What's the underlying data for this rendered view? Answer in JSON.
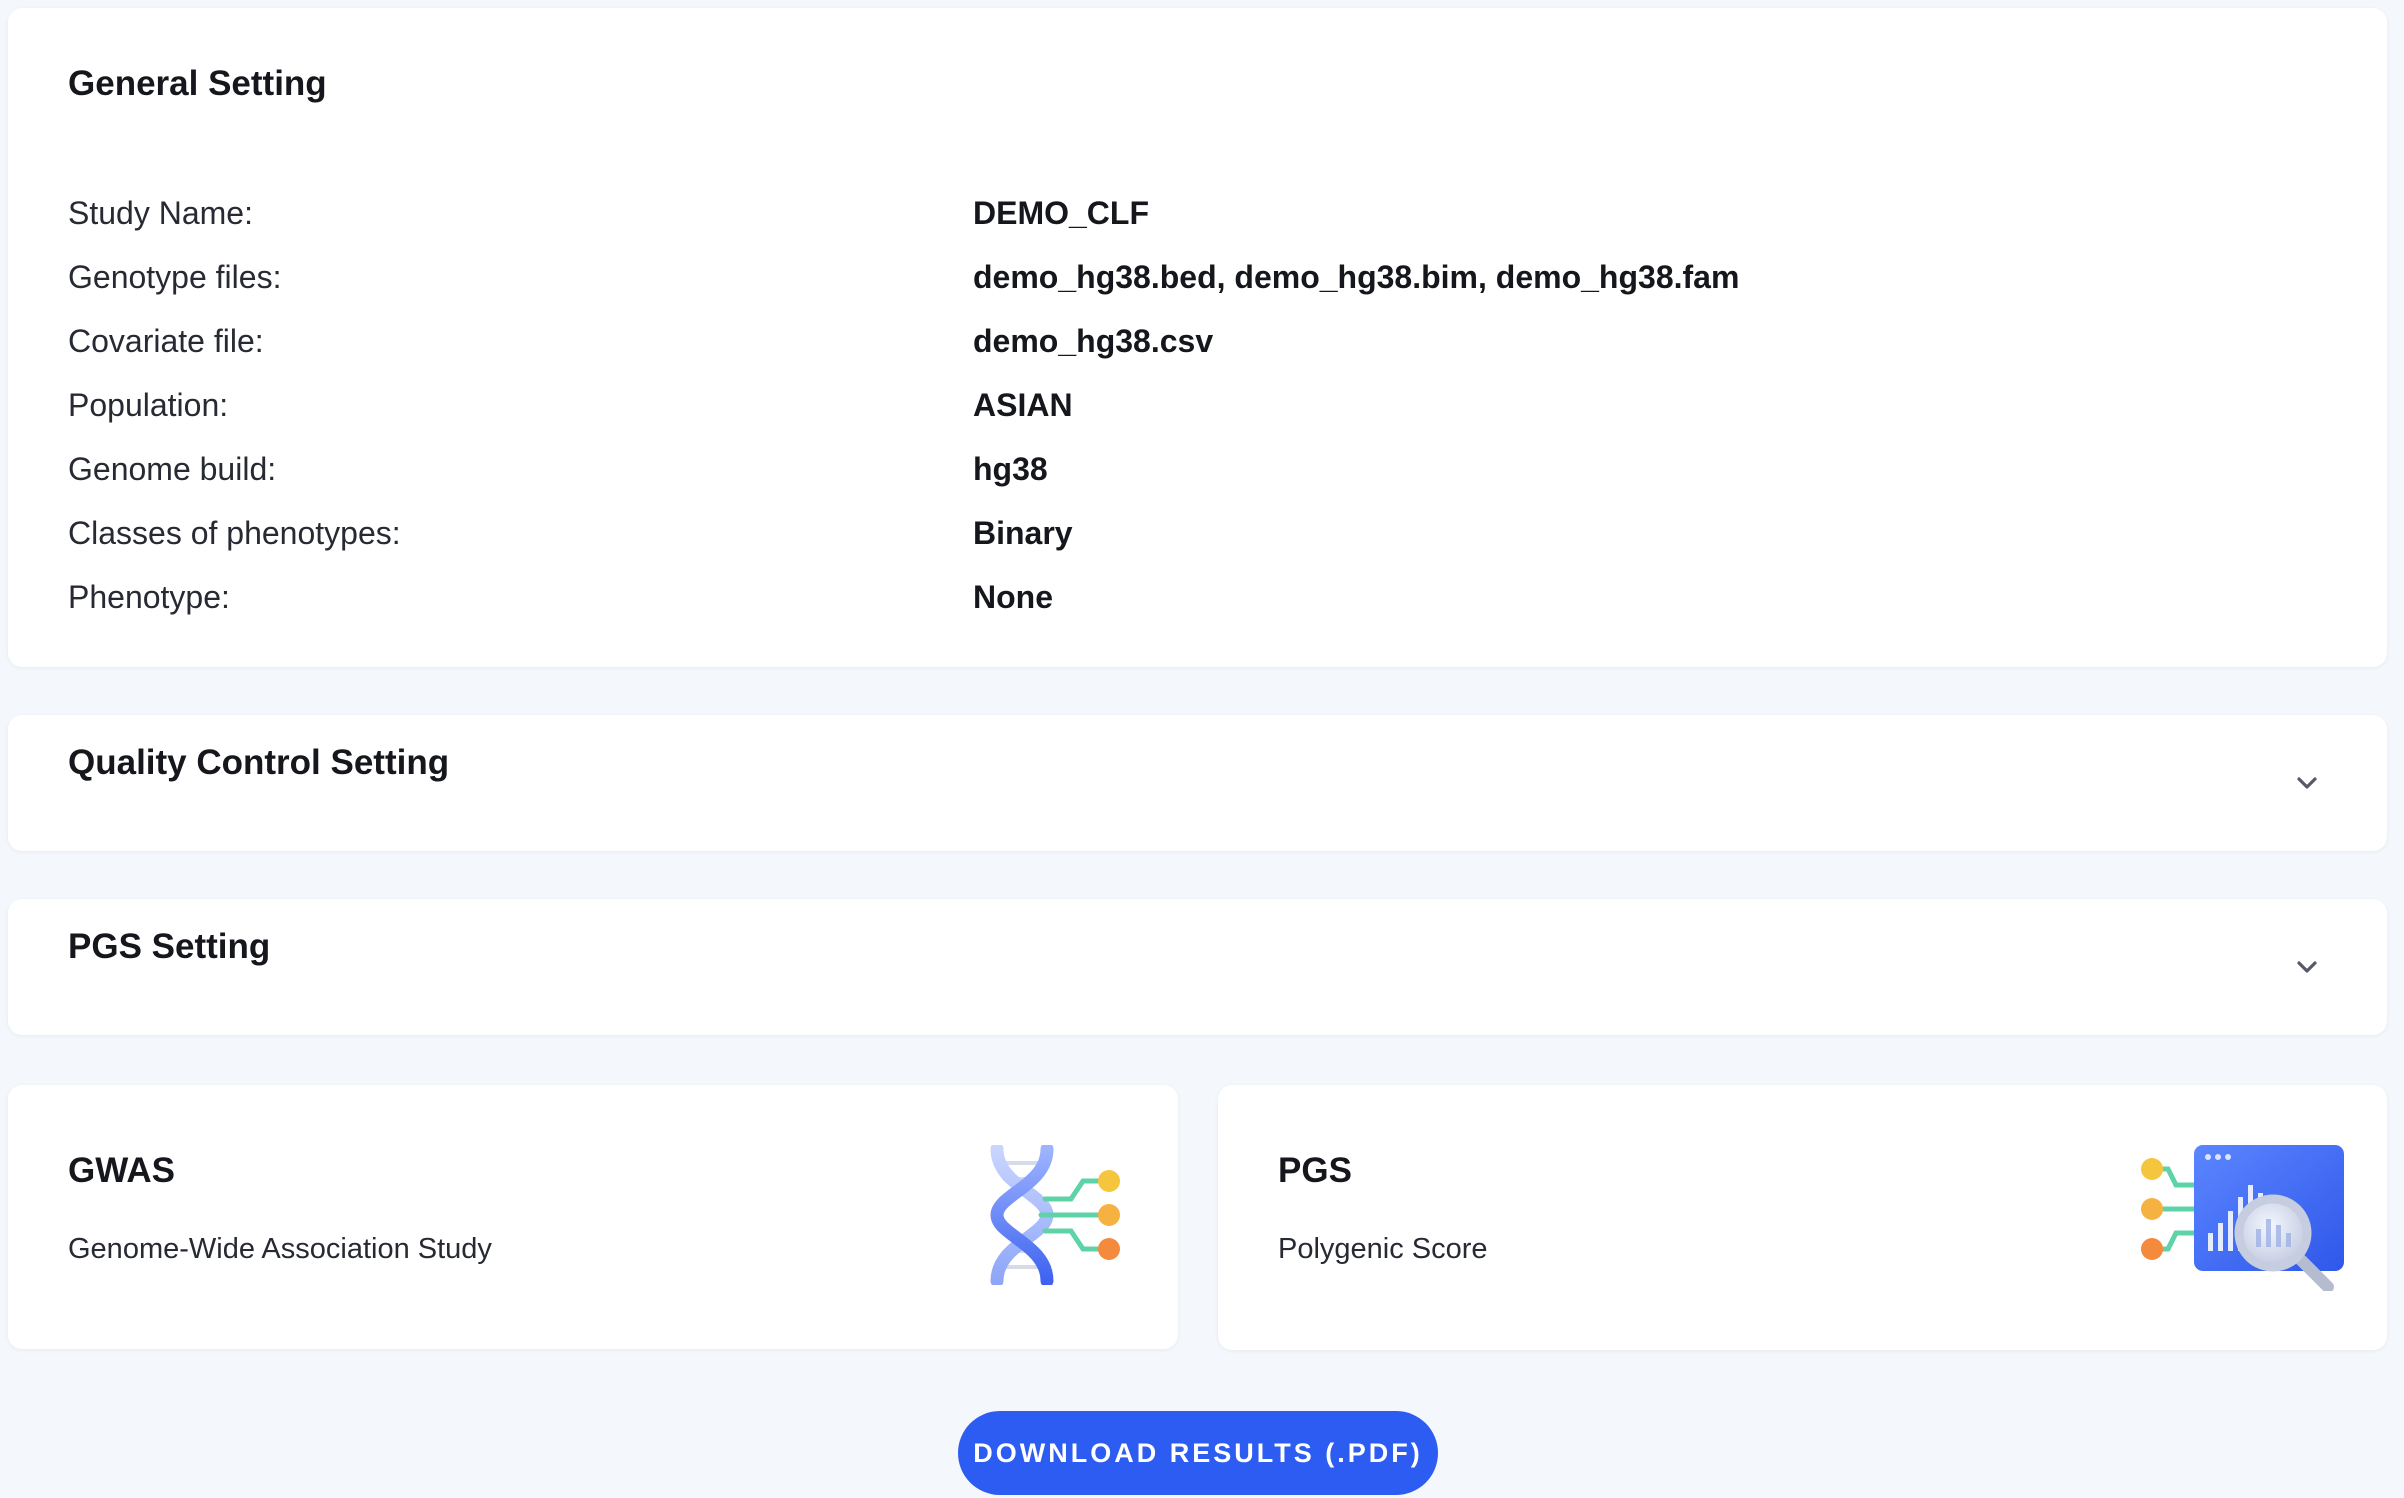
{
  "general": {
    "title": "General Setting",
    "rows": [
      {
        "label": "Study Name:",
        "value": "DEMO_CLF"
      },
      {
        "label": "Genotype files:",
        "value": "demo_hg38.bed, demo_hg38.bim, demo_hg38.fam"
      },
      {
        "label": "Covariate file:",
        "value": "demo_hg38.csv"
      },
      {
        "label": "Population:",
        "value": "ASIAN"
      },
      {
        "label": "Genome build:",
        "value": "hg38"
      },
      {
        "label": "Classes of phenotypes:",
        "value": "Binary"
      },
      {
        "label": "Phenotype:",
        "value": "None"
      }
    ]
  },
  "quality_control": {
    "title": "Quality Control Setting",
    "expand_icon": "chevron-down-icon"
  },
  "pgs_setting": {
    "title": "PGS Setting",
    "expand_icon": "chevron-down-icon"
  },
  "features": [
    {
      "title": "GWAS",
      "subtitle": "Genome-Wide Association Study",
      "icon": "dna-icon"
    },
    {
      "title": "PGS",
      "subtitle": "Polygenic Score",
      "icon": "chart-magnifier-icon"
    }
  ],
  "download_button": {
    "label": "DOWNLOAD RESULTS (.PDF)"
  },
  "colors": {
    "page_background": "#f4f7fb",
    "card_background": "#ffffff",
    "accent_blue": "#2c5cf2",
    "text_primary": "#15171c",
    "text_secondary": "#272a33"
  }
}
